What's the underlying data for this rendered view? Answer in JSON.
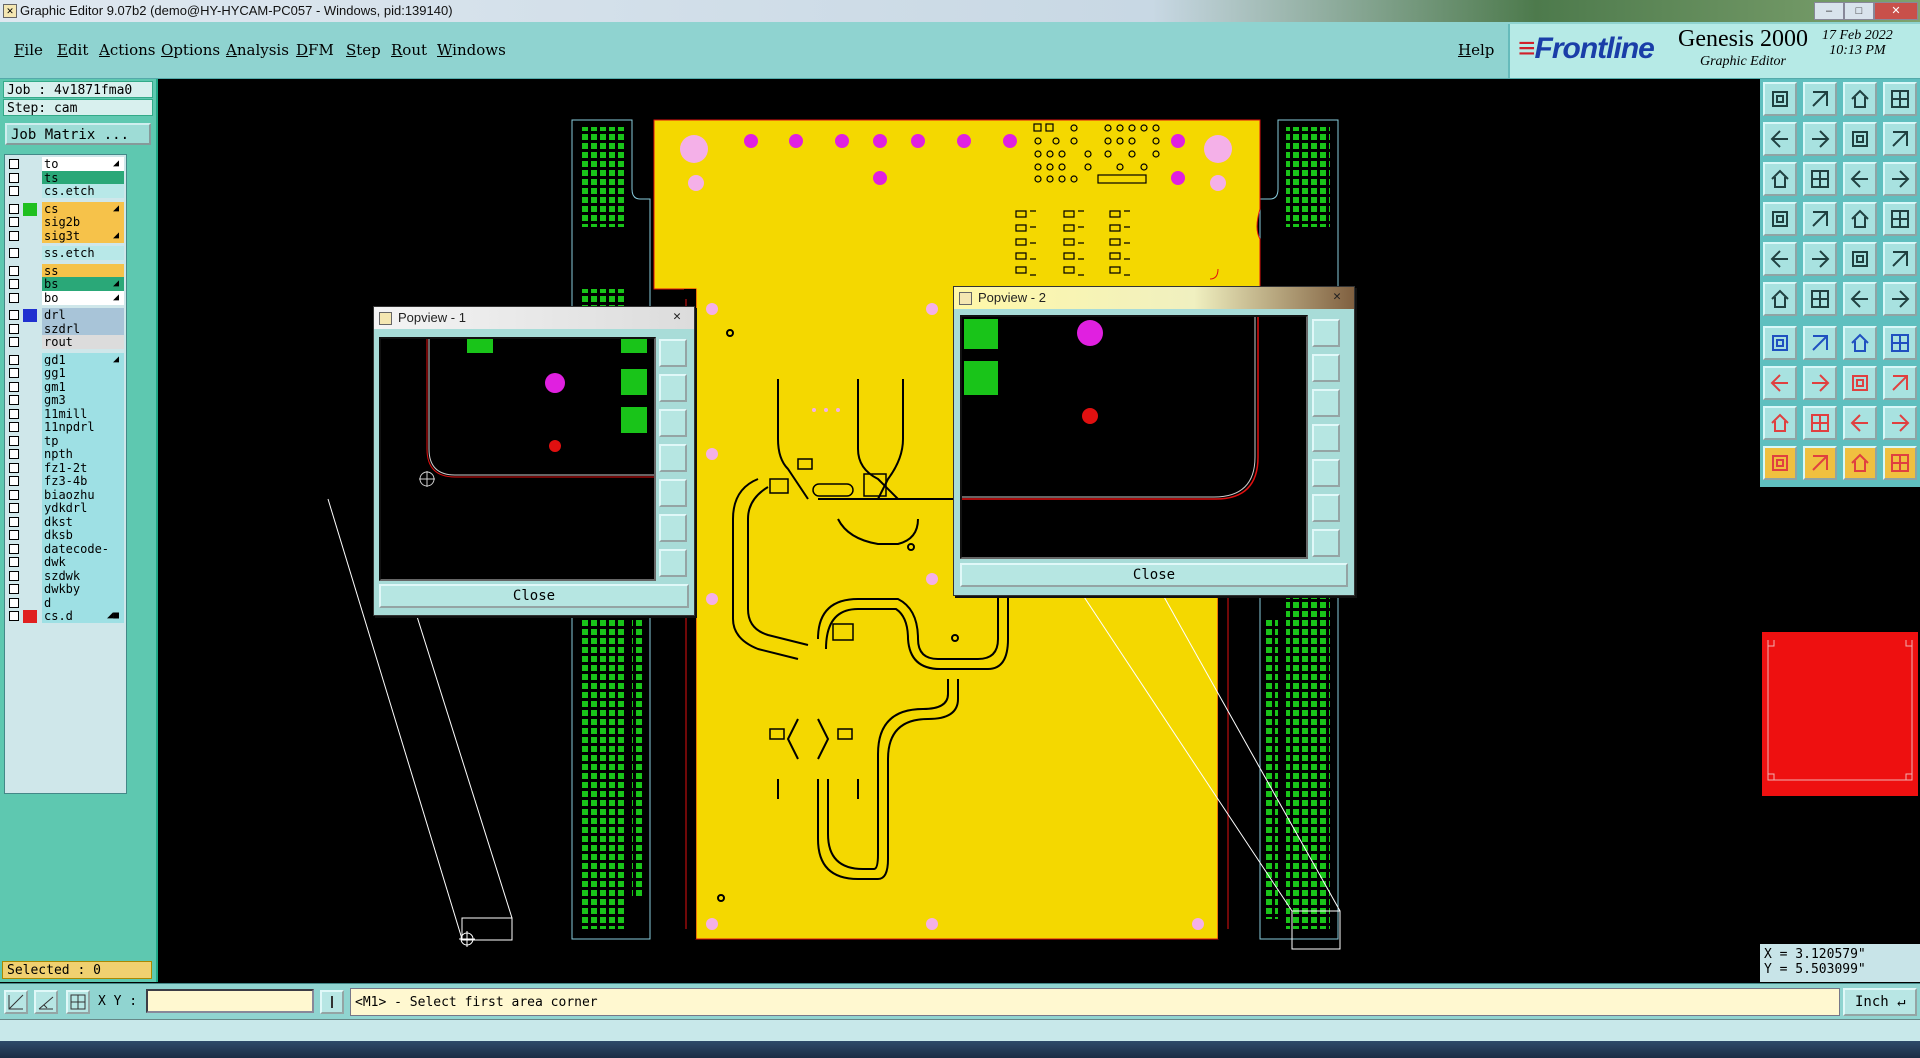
{
  "window": {
    "title": "Graphic Editor 9.07b2 (demo@HY-HYCAM-PC057 - Windows, pid:139140)"
  },
  "menu": {
    "items": [
      "File",
      "Edit",
      "Actions",
      "Options",
      "Analysis",
      "DFM",
      "Step",
      "Rout",
      "Windows"
    ],
    "help": "Help"
  },
  "brand": {
    "logo": "Frontline",
    "product": "Genesis 2000",
    "subtitle": "Graphic Editor",
    "date": "17 Feb 2022",
    "time": "10:13 PM"
  },
  "job": {
    "job_label": "Job : 4v1871fma0",
    "step_label": "Step: cam",
    "matrix_button": "Job Matrix ..."
  },
  "layers": [
    {
      "name": "to",
      "bg": "#ffffff",
      "swatch": "",
      "ind": "◢"
    },
    {
      "name": "ts",
      "bg": "#2aa878",
      "swatch": "",
      "ind": ""
    },
    {
      "name": "cs.etch",
      "bg": "#b8e8e8",
      "swatch": "",
      "ind": ""
    },
    {
      "name": "cs",
      "bg": "#f6c24a",
      "swatch": "#20c020",
      "ind": "◢"
    },
    {
      "name": "sig2b",
      "bg": "#f6c24a",
      "swatch": "",
      "ind": ""
    },
    {
      "name": "sig3t",
      "bg": "#f6c24a",
      "swatch": "",
      "ind": "◢"
    },
    {
      "name": "ss.etch",
      "bg": "#b8e8e8",
      "swatch": "",
      "ind": ""
    },
    {
      "name": "ss",
      "bg": "#f6c24a",
      "swatch": "",
      "ind": ""
    },
    {
      "name": "bs",
      "bg": "#2aa878",
      "swatch": "",
      "ind": "◢"
    },
    {
      "name": "bo",
      "bg": "#ffffff",
      "swatch": "",
      "ind": "◢"
    },
    {
      "name": "drl",
      "bg": "#a8c4d8",
      "swatch": "#2030d0",
      "ind": ""
    },
    {
      "name": "szdrl",
      "bg": "#a8c4d8",
      "swatch": "",
      "ind": ""
    },
    {
      "name": "rout",
      "bg": "#dcdcdc",
      "swatch": "",
      "ind": ""
    },
    {
      "name": "gd1",
      "bg": "#9ee0e4",
      "swatch": "",
      "ind": "◢"
    },
    {
      "name": "gg1",
      "bg": "#9ee0e4",
      "swatch": "",
      "ind": ""
    },
    {
      "name": "gm1",
      "bg": "#9ee0e4",
      "swatch": "",
      "ind": ""
    },
    {
      "name": "gm3",
      "bg": "#9ee0e4",
      "swatch": "",
      "ind": ""
    },
    {
      "name": "11mill",
      "bg": "#9ee0e4",
      "swatch": "",
      "ind": ""
    },
    {
      "name": "11npdrl",
      "bg": "#9ee0e4",
      "swatch": "",
      "ind": ""
    },
    {
      "name": "tp",
      "bg": "#9ee0e4",
      "swatch": "",
      "ind": ""
    },
    {
      "name": "npth",
      "bg": "#9ee0e4",
      "swatch": "",
      "ind": ""
    },
    {
      "name": "fz1-2t",
      "bg": "#9ee0e4",
      "swatch": "",
      "ind": ""
    },
    {
      "name": "fz3-4b",
      "bg": "#9ee0e4",
      "swatch": "",
      "ind": ""
    },
    {
      "name": "biaozhu",
      "bg": "#9ee0e4",
      "swatch": "",
      "ind": ""
    },
    {
      "name": "ydkdrl",
      "bg": "#9ee0e4",
      "swatch": "",
      "ind": ""
    },
    {
      "name": "dkst",
      "bg": "#9ee0e4",
      "swatch": "",
      "ind": ""
    },
    {
      "name": "dksb",
      "bg": "#9ee0e4",
      "swatch": "",
      "ind": ""
    },
    {
      "name": "datecode-pte",
      "bg": "#9ee0e4",
      "swatch": "",
      "ind": ""
    },
    {
      "name": "dwk",
      "bg": "#9ee0e4",
      "swatch": "",
      "ind": ""
    },
    {
      "name": "szdwk",
      "bg": "#9ee0e4",
      "swatch": "",
      "ind": ""
    },
    {
      "name": "dwkby",
      "bg": "#9ee0e4",
      "swatch": "",
      "ind": ""
    },
    {
      "name": "d",
      "bg": "#9ee0e4",
      "swatch": "",
      "ind": ""
    },
    {
      "name": "cs.d",
      "bg": "#9ee0e4",
      "swatch": "#e02020",
      "ind": "◢■"
    }
  ],
  "selected": "Selected : 0",
  "popview1": {
    "title": "Popview - 1",
    "close": "Close"
  },
  "popview2": {
    "title": "Popview - 2",
    "close": "Close"
  },
  "coords": {
    "x": "X = 3.120579\"",
    "y": "Y = 5.503099\""
  },
  "bottom": {
    "xy_label": "X Y :",
    "xy_value": "",
    "prompt": "<M1> - Select first area corner",
    "unit": "Inch"
  },
  "colors": {
    "board": "#f4d800",
    "copper_green": "#19c419",
    "pad_magenta": "#e020e0",
    "pad_pink": "#f4b0e8",
    "outline_red": "#e01010"
  }
}
